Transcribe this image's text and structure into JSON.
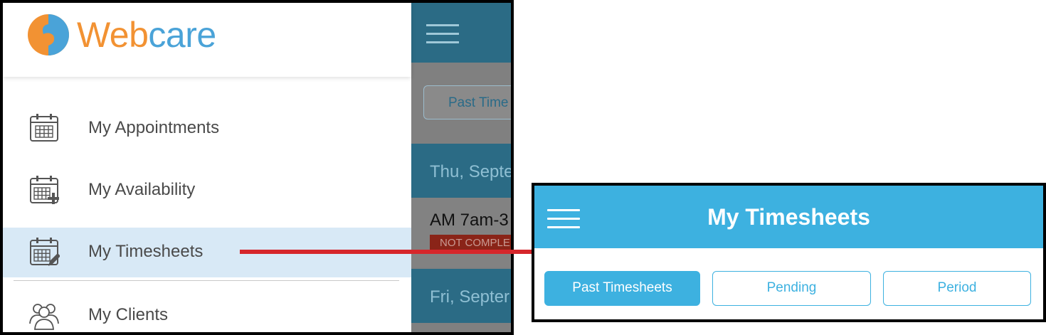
{
  "drawer": {
    "logo_text": "Webcare",
    "items": [
      {
        "label": "My Appointments",
        "icon": "calendar-icon",
        "active": false
      },
      {
        "label": "My Availability",
        "icon": "calendar-add-icon",
        "active": false
      },
      {
        "label": "My Timesheets",
        "icon": "calendar-edit-icon",
        "active": true
      },
      {
        "label": "My Clients",
        "icon": "clients-icon",
        "active": false
      }
    ]
  },
  "background_app": {
    "segment_label": "Past Time",
    "date_1": "Thu, Septe",
    "shift_title": "AM 7am-3",
    "status_badge": "NOT COMPLE",
    "date_2": "Fri, Septer"
  },
  "timesheets_screen": {
    "title": "My Timesheets",
    "segments": [
      {
        "label": "Past Timesheets",
        "active": true
      },
      {
        "label": "Pending",
        "active": false
      },
      {
        "label": "Period",
        "active": false
      }
    ]
  },
  "colors": {
    "accent": "#3db1e0",
    "logo_orange": "#f29233",
    "arrow": "#d6262b",
    "active_row": "#d8e9f6",
    "dark_header": "#2b6b85"
  }
}
